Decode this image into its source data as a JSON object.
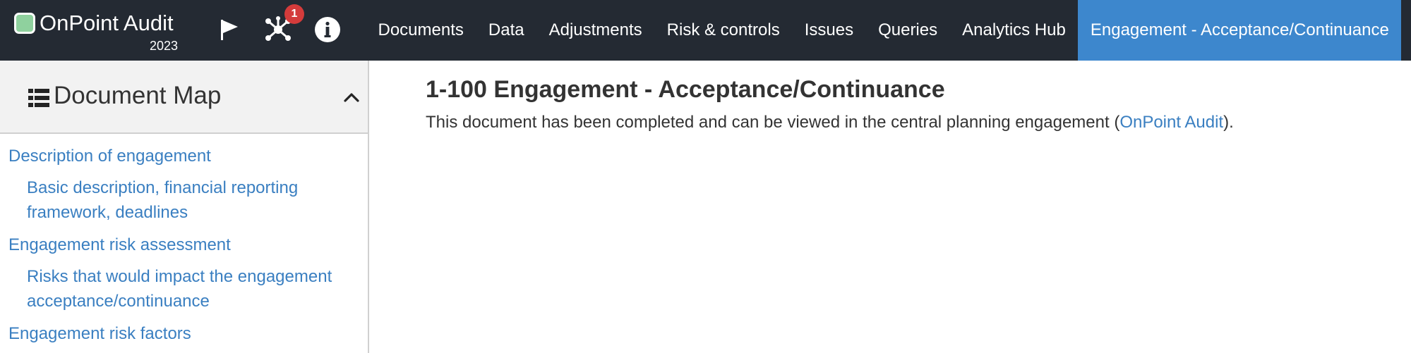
{
  "app": {
    "title": "OnPoint Audit",
    "year": "2023"
  },
  "toolbar": {
    "flag_icon": "flag-icon",
    "graph_icon": "network-graph-icon",
    "graph_badge": "1",
    "info_icon": "info-icon"
  },
  "nav": {
    "items": [
      {
        "label": "Documents"
      },
      {
        "label": "Data"
      },
      {
        "label": "Adjustments"
      },
      {
        "label": "Risk & controls"
      },
      {
        "label": "Issues"
      },
      {
        "label": "Queries"
      },
      {
        "label": "Analytics Hub"
      },
      {
        "label": "Engagement - Acceptance/Continuance"
      }
    ],
    "active_index": 7
  },
  "document_map": {
    "title": "Document Map",
    "items": [
      {
        "label": "Description of engagement",
        "level": 1
      },
      {
        "label": "Basic description, financial reporting framework, deadlines",
        "level": 2
      },
      {
        "label": "Engagement risk assessment",
        "level": 1
      },
      {
        "label": "Risks that would impact the engagement acceptance/continuance",
        "level": 2
      },
      {
        "label": "Engagement risk factors",
        "level": 1
      }
    ]
  },
  "main": {
    "title": "1-100 Engagement - Acceptance/Continuance",
    "message_before": "This document has been completed and can be viewed in the central planning engagement (",
    "message_link": "OnPoint Audit",
    "message_after": ")."
  },
  "colors": {
    "topbar": "#242a33",
    "active_tab": "#3d87cd",
    "link": "#3a7fc1",
    "badge": "#d43b3b",
    "logo": "#8fd19e"
  }
}
